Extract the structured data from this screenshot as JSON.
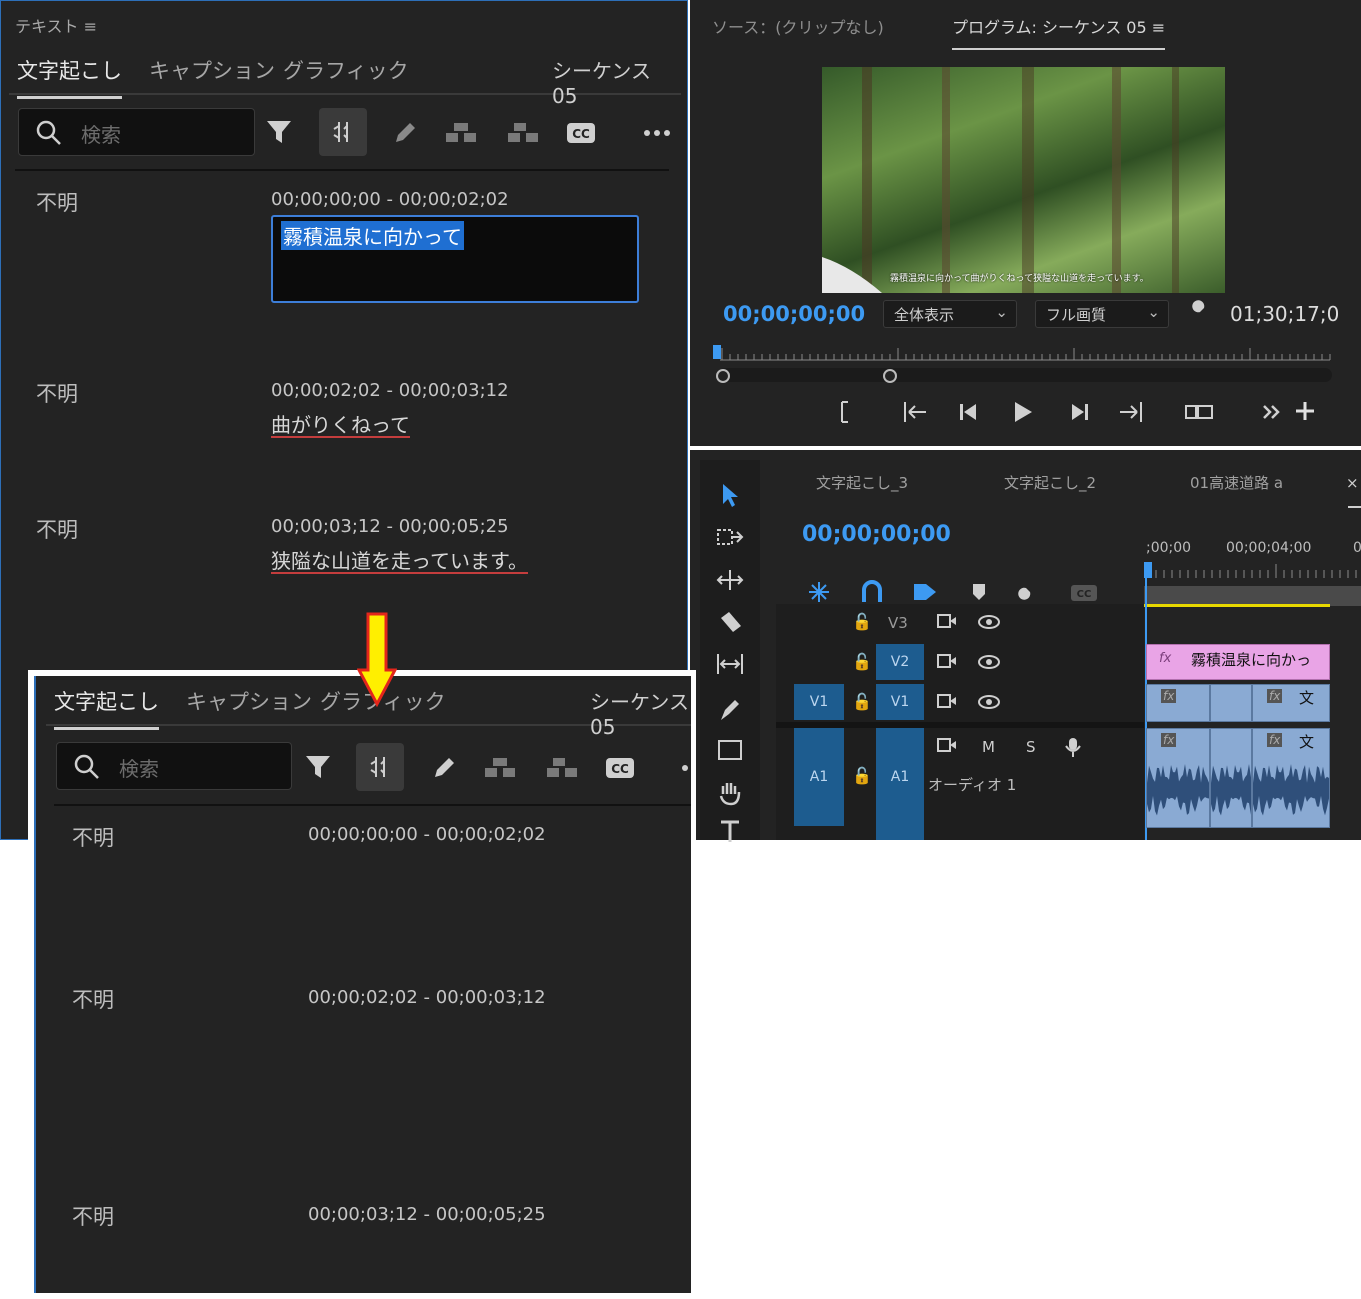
{
  "text_panel": {
    "header": "テキスト ≡",
    "tabs": [
      "文字起こし",
      "キャプション",
      "グラフィック"
    ],
    "sequence": "シーケンス 05",
    "search_placeholder": "検索",
    "entries": [
      {
        "speaker": "不明",
        "timecode": "00;00;00;00 - 00;00;02;02",
        "text": "霧積温泉に向かって"
      },
      {
        "speaker": "不明",
        "timecode": "00;00;02;02 - 00;00;03;12",
        "text": "曲がりくねって"
      },
      {
        "speaker": "不明",
        "timecode": "00;00;03;12 - 00;00;05;25",
        "text": "狭隘な山道を走っています。"
      }
    ],
    "toolbar_icons": [
      "search-icon",
      "filter-icon",
      "split-icon",
      "pencil-icon",
      "merge-icon",
      "merge-alt-icon",
      "cc-icon",
      "more-icon"
    ]
  },
  "program": {
    "source_tab": "ソース：(クリップなし)",
    "program_tab": "プログラム: シーケンス 05 ≡",
    "video_subtitle": "霧積温泉に向かって曲がりくねって狭隘な山道を走っています。",
    "timecode": "00;00;00;00",
    "zoom": "全体表示",
    "quality": "フル画質",
    "duration": "01;30;17;0"
  },
  "timeline": {
    "tabs": [
      "文字起こし_3",
      "文字起こし_2",
      "01高速道路 a"
    ],
    "close": "×",
    "timecode": "00;00;00;00",
    "ruler": [
      ";00;00",
      "00;00;04;00",
      "0"
    ],
    "tracks": [
      {
        "name": "V3",
        "src": ""
      },
      {
        "name": "V2",
        "src": ""
      },
      {
        "name": "V1",
        "src": "V1"
      },
      {
        "name": "A1",
        "src": "A1"
      }
    ],
    "audio_label": "オーディオ 1",
    "m": "M",
    "s": "S",
    "caption_clip": "霧積温泉に向かっ",
    "fx": "fx",
    "clip_text": "文"
  },
  "zoom_panel": {
    "tabs": [
      "文字起こし",
      "キャプション",
      "グラフィック"
    ],
    "sequence": "シーケンス 05",
    "search_placeholder": "検索",
    "entries": [
      {
        "speaker": "不明",
        "timecode": "00;00;00;00 - 00;00;02;02"
      },
      {
        "speaker": "不明",
        "timecode": "00;00;02;02 - 00;00;03;12"
      },
      {
        "speaker": "不明",
        "timecode": "00;00;03;12 - 00;00;05;25"
      }
    ]
  },
  "colors": {
    "accent": "#3d9af2",
    "arrow": "#ffef00",
    "arrow_border": "#e3261b",
    "caption_clip": "#e9a4e6"
  }
}
